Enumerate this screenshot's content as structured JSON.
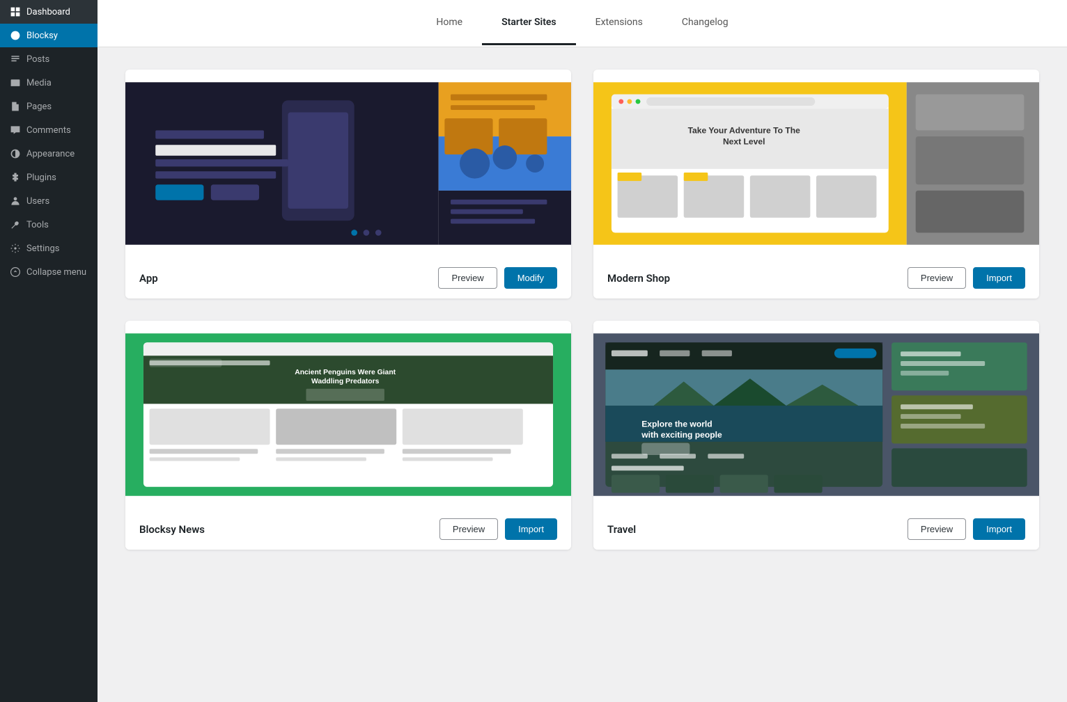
{
  "sidebar": {
    "items": [
      {
        "id": "dashboard",
        "label": "Dashboard",
        "icon": "dashboard"
      },
      {
        "id": "blocksy",
        "label": "Blocksy",
        "icon": "blocksy",
        "active": true
      },
      {
        "id": "posts",
        "label": "Posts",
        "icon": "posts"
      },
      {
        "id": "media",
        "label": "Media",
        "icon": "media"
      },
      {
        "id": "pages",
        "label": "Pages",
        "icon": "pages"
      },
      {
        "id": "comments",
        "label": "Comments",
        "icon": "comments"
      },
      {
        "id": "appearance",
        "label": "Appearance",
        "icon": "appearance"
      },
      {
        "id": "plugins",
        "label": "Plugins",
        "icon": "plugins"
      },
      {
        "id": "users",
        "label": "Users",
        "icon": "users"
      },
      {
        "id": "tools",
        "label": "Tools",
        "icon": "tools"
      },
      {
        "id": "settings",
        "label": "Settings",
        "icon": "settings"
      },
      {
        "id": "collapse",
        "label": "Collapse menu",
        "icon": "collapse"
      }
    ]
  },
  "tabs": [
    {
      "id": "home",
      "label": "Home",
      "active": false
    },
    {
      "id": "starter-sites",
      "label": "Starter Sites",
      "active": true
    },
    {
      "id": "extensions",
      "label": "Extensions",
      "active": false
    },
    {
      "id": "changelog",
      "label": "Changelog",
      "active": false
    }
  ],
  "cards": [
    {
      "id": "app",
      "title": "App",
      "preview_label": "Preview",
      "action_label": "Modify",
      "action_type": "modify"
    },
    {
      "id": "modern-shop",
      "title": "Modern Shop",
      "preview_label": "Preview",
      "action_label": "Import",
      "action_type": "import"
    },
    {
      "id": "blocksy-news",
      "title": "Blocksy News",
      "preview_label": "Preview",
      "action_label": "Import",
      "action_type": "import"
    },
    {
      "id": "travel",
      "title": "Travel",
      "preview_label": "Preview",
      "action_label": "Import",
      "action_type": "import"
    }
  ]
}
